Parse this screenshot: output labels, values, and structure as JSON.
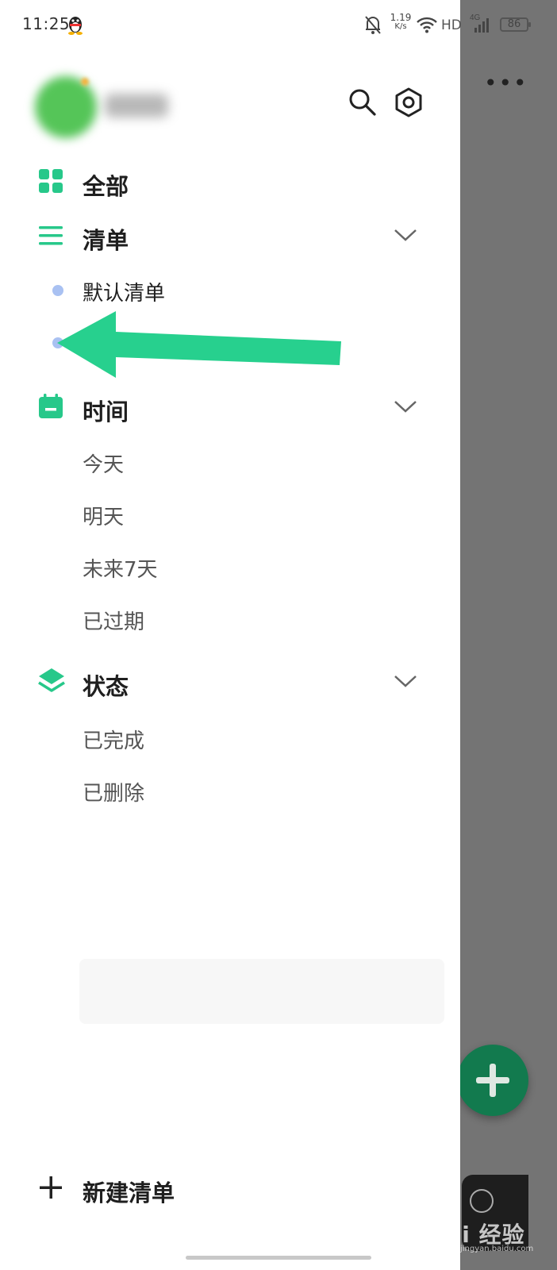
{
  "status_bar": {
    "time": "11:25",
    "net_speed_value": "1.19",
    "net_speed_unit": "K/s",
    "hd_label": "HD",
    "network_type": "4G",
    "battery": "86"
  },
  "drawer": {
    "sections": [
      {
        "label": "全部"
      },
      {
        "label": "清单",
        "items": [
          "默认清单",
          ""
        ]
      },
      {
        "label": "时间",
        "items": [
          "今天",
          "明天",
          "未来7天",
          "已过期"
        ]
      },
      {
        "label": "状态",
        "items": [
          "已完成",
          "已删除"
        ]
      }
    ],
    "new_list_label": "新建清单"
  },
  "colors": {
    "accent": "#27c88a",
    "annotation_arrow": "#27d08e",
    "list_dot": "#a9c1f2",
    "scrim": "#747474"
  },
  "watermark": {
    "text": "Bai 经验",
    "sub": "jingyan.baidu.com"
  }
}
